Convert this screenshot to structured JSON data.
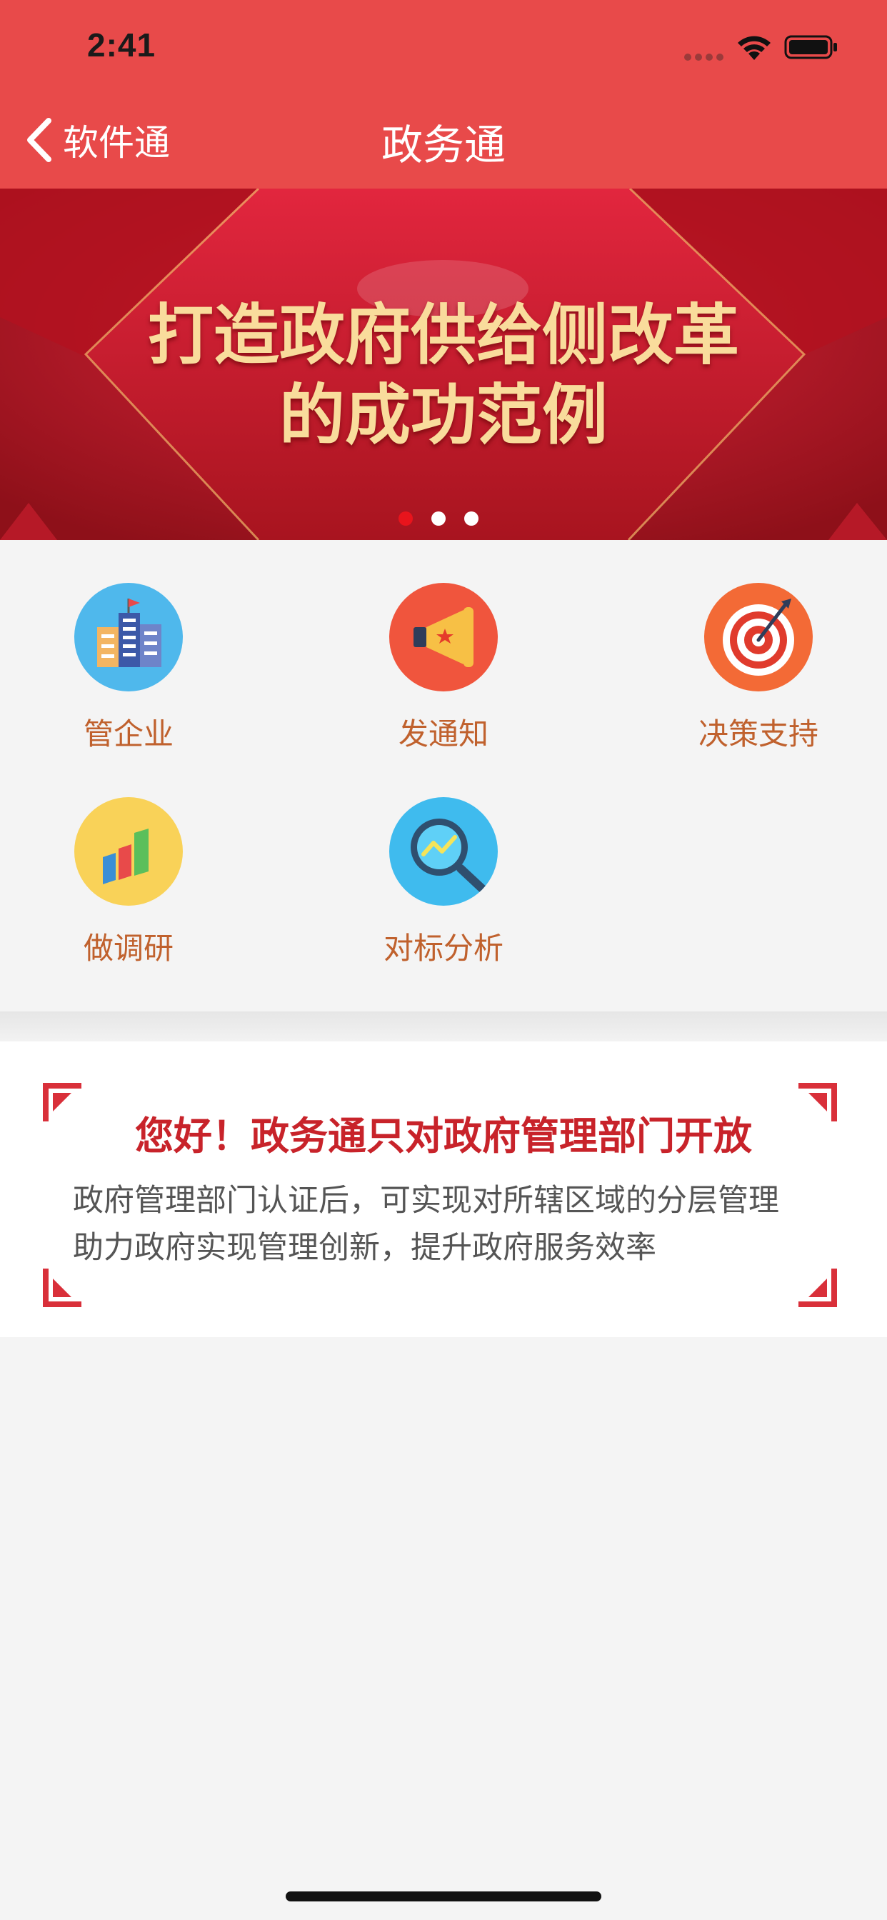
{
  "status_bar": {
    "time": "2:41"
  },
  "nav": {
    "back_label": "软件通",
    "title": "政务通"
  },
  "banner": {
    "line1": "打造政府供给侧改革",
    "line2": "的成功范例",
    "slide_count": 3,
    "active_index": 0
  },
  "grid": {
    "items": [
      {
        "label": "管企业",
        "icon": "company-buildings-icon",
        "color": "#4fb8ec"
      },
      {
        "label": "发通知",
        "icon": "megaphone-icon",
        "color": "#f0553d"
      },
      {
        "label": "决策支持",
        "icon": "target-dart-icon",
        "color": "#f36a36"
      },
      {
        "label": "做调研",
        "icon": "bar-chart-icon",
        "color": "#f9d258"
      },
      {
        "label": "对标分析",
        "icon": "magnifier-trend-icon",
        "color": "#3fbbee"
      }
    ]
  },
  "notice": {
    "title": "您好！政务通只对政府管理部门开放",
    "line1": "政府管理部门认证后，可实现对所辖区域的分层管理",
    "line2": "助力政府实现管理创新，提升政府服务效率"
  },
  "colors": {
    "header": "#e84a4a",
    "accent_red": "#c8232a",
    "label_orange": "#c0612d",
    "banner_text": "#f9dc9c"
  }
}
